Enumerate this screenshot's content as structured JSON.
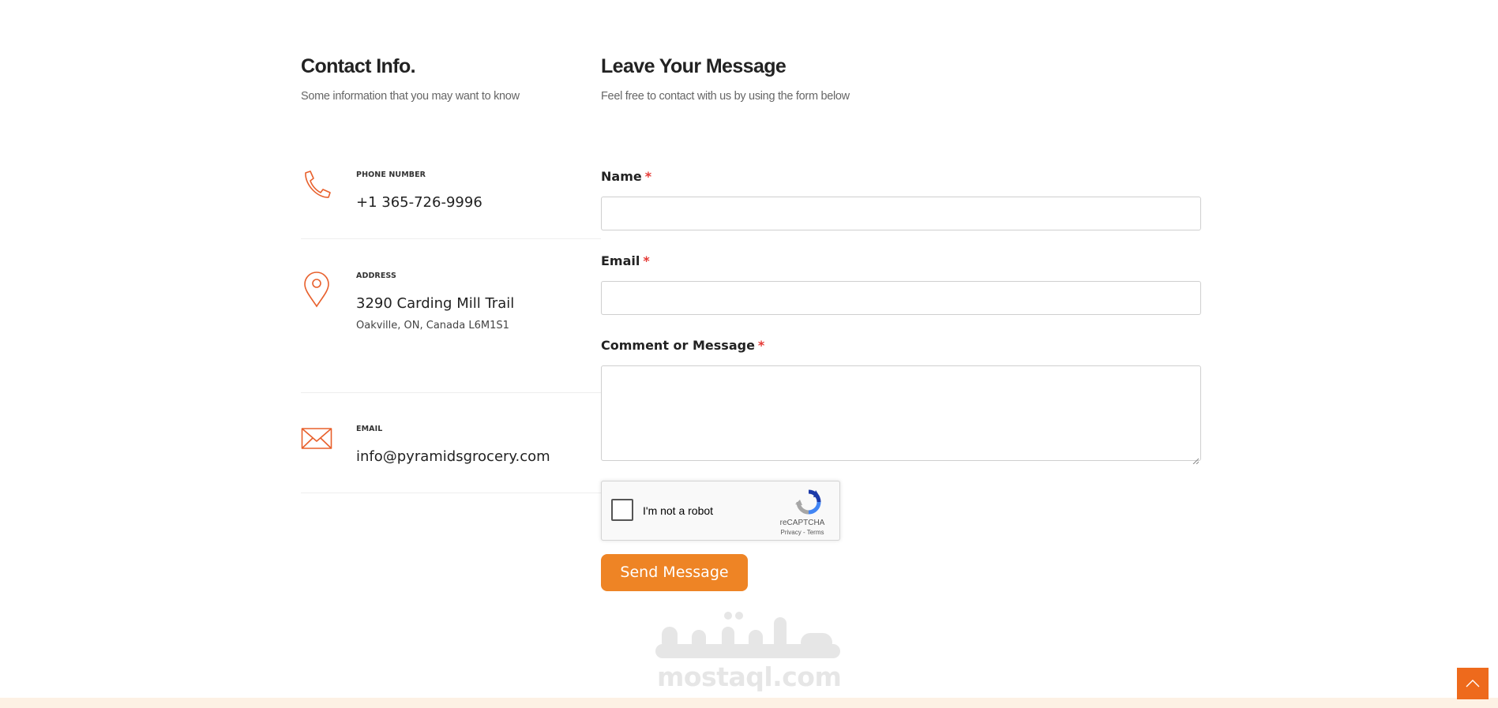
{
  "contact": {
    "title": "Contact Info.",
    "subtitle": "Some information that you may want to know",
    "items": [
      {
        "label": "PHONE NUMBER",
        "value": "+1 365-726-9996",
        "icon": "phone-icon"
      },
      {
        "label": "ADDRESS",
        "value": "3290 Carding Mill Trail",
        "extra": "Oakville, ON, Canada L6M1S1",
        "icon": "map-pin-icon"
      },
      {
        "label": "EMAIL",
        "value": "info@pyramidsgrocery.com",
        "icon": "envelope-icon"
      }
    ]
  },
  "form": {
    "title": "Leave Your Message",
    "subtitle": "Feel free to contact with us by using the form below",
    "required_mark": "*",
    "name_label": "Name",
    "email_label": "Email",
    "message_label": "Comment or Message",
    "captcha": {
      "text": "I'm not a robot",
      "brand": "reCAPTCHA",
      "links": "Privacy - Terms"
    },
    "submit_label": "Send Message"
  },
  "watermark": {
    "arabic": "مستقل",
    "latin": "mostaql.com"
  },
  "colors": {
    "accent": "#ee8425",
    "icon": "#e8602c",
    "required": "#e53935",
    "scroll_top": "#ee6a1c",
    "footer_band": "#fdf1e4"
  },
  "scroll_top_icon": "chevron-up-icon"
}
